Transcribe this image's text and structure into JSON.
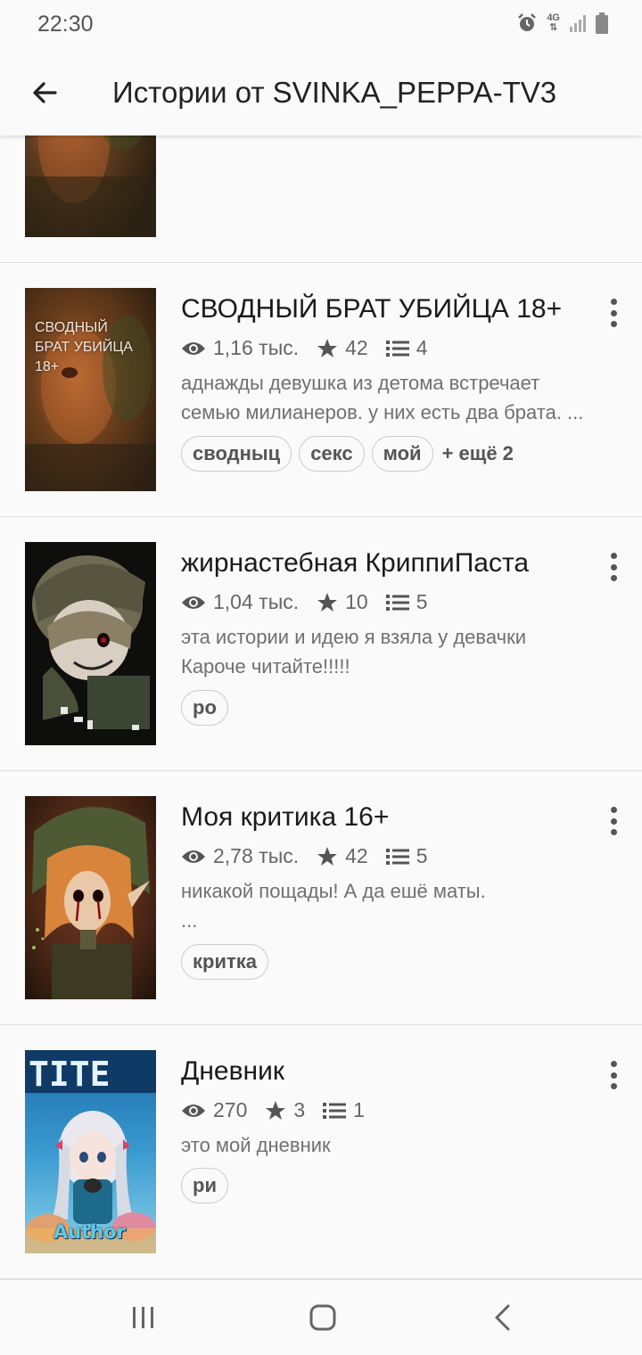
{
  "status_bar": {
    "time": "22:30",
    "network": "4G",
    "icons": [
      "alarm-icon",
      "network-4g-icon",
      "signal-icon",
      "battery-icon"
    ]
  },
  "app_bar": {
    "title": "Истории от SVINKA_PEPPA-TV3",
    "back_icon": "arrow-back-icon"
  },
  "stories": [
    {
      "title": "СВОДНЫЙ БРАТ УБИЙЦА 18+",
      "cover_text": "СВОДНЫЙ БРАТ УБИЙЦА 18+",
      "views": "1,16 тыс.",
      "votes": "42",
      "parts": "4",
      "description": [
        "аднажды девушка из детома встречает",
        "семью милианеров. у них есть два брата. ..."
      ],
      "tags": [
        "сводныц",
        "секс",
        "мой"
      ],
      "more_tags": "+ ещё 2"
    },
    {
      "title": "жирнастебная КриппиПаста",
      "views": "1,04 тыс.",
      "votes": "10",
      "parts": "5",
      "description": [
        "эта истории и идею я взяла у девачки",
        "Кароче читайте!!!!!"
      ],
      "tags": [
        "ро"
      ]
    },
    {
      "title": "Моя критика 16+",
      "views": "2,78 тыс.",
      "votes": "42",
      "parts": "5",
      "description": [
        "никакой пощады! А да ешё маты.",
        "..."
      ],
      "tags": [
        "критка"
      ]
    },
    {
      "title": "Дневник",
      "cover_text": "Author",
      "views": "270",
      "votes": "3",
      "parts": "1",
      "description": [
        "это мой дневник"
      ],
      "tags": [
        "ри"
      ]
    }
  ],
  "nav_bar": {
    "icons": [
      "recent-apps-icon",
      "home-icon",
      "back-icon"
    ]
  },
  "colors": {
    "background": "#fafafa",
    "text_primary": "#1a1a1a",
    "text_secondary": "#707070",
    "divider": "#dddddd"
  }
}
